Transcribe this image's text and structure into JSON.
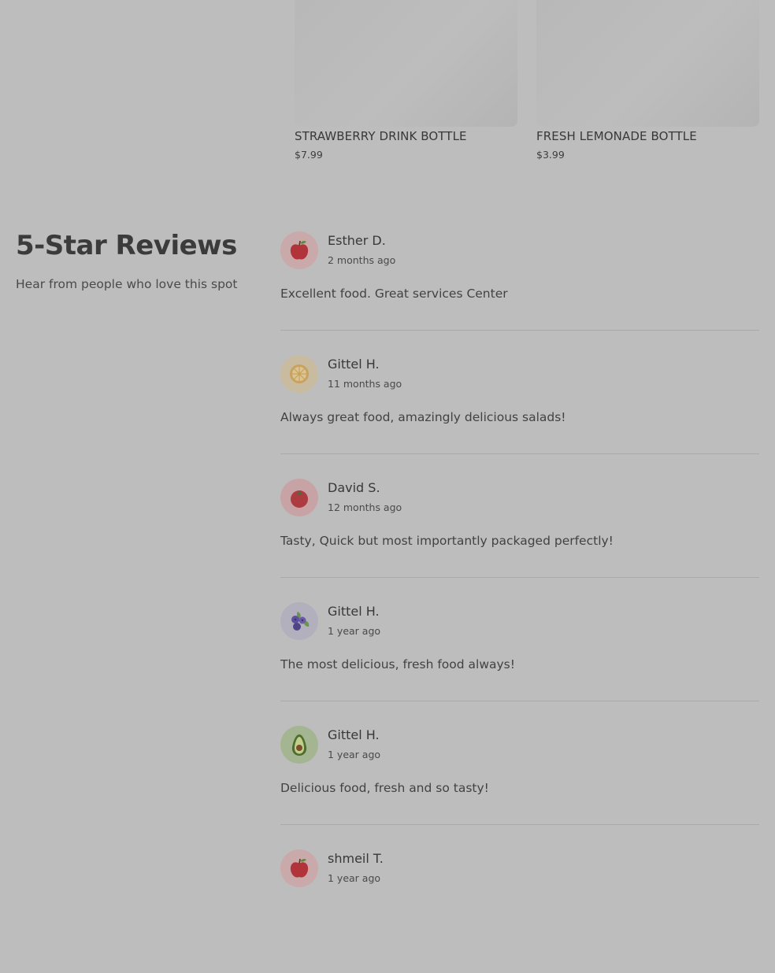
{
  "products": [
    {
      "name": "STRAWBERRY DRINK BOTTLE",
      "price": "$7.99"
    },
    {
      "name": "FRESH LEMONADE BOTTLE",
      "price": "$3.99"
    }
  ],
  "reviews_section": {
    "title": "5-Star Reviews",
    "subtitle": "Hear from people who love this spot"
  },
  "reviews": [
    {
      "name": "Esther D.",
      "date": "2 months ago",
      "text": "Excellent food. Great services Center",
      "avatar_icon": "apple-icon",
      "avatar_bg": "#c9a9a9"
    },
    {
      "name": "Gittel H.",
      "date": "11 months ago",
      "text": "Always great food, amazingly delicious salads!",
      "avatar_icon": "lemon-icon",
      "avatar_bg": "#c9bba0"
    },
    {
      "name": "David S.",
      "date": "12 months ago",
      "text": "Tasty, Quick but most importantly packaged perfectly!",
      "avatar_icon": "tomato-icon",
      "avatar_bg": "#c7a3a6"
    },
    {
      "name": "Gittel H.",
      "date": "1 year ago",
      "text": "The most delicious, fresh food always!",
      "avatar_icon": "blueberry-icon",
      "avatar_bg": "#b3b0bd"
    },
    {
      "name": "Gittel H.",
      "date": "1 year ago",
      "text": "Delicious food, fresh and so tasty!",
      "avatar_icon": "avocado-icon",
      "avatar_bg": "#a4b592"
    },
    {
      "name": "shmeil T.",
      "date": "1 year ago",
      "text": "",
      "avatar_icon": "apple-icon",
      "avatar_bg": "#c9a9a9"
    }
  ]
}
